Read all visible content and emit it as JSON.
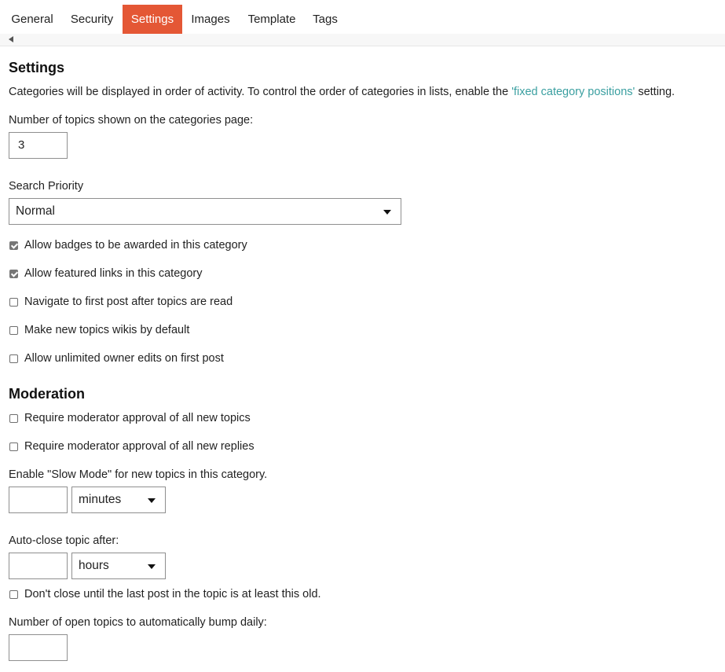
{
  "tabs": [
    {
      "label": "General",
      "active": false
    },
    {
      "label": "Security",
      "active": false
    },
    {
      "label": "Settings",
      "active": true
    },
    {
      "label": "Images",
      "active": false
    },
    {
      "label": "Template",
      "active": false
    },
    {
      "label": "Tags",
      "active": false
    }
  ],
  "settings": {
    "heading": "Settings",
    "description_prefix": "Categories will be displayed in order of activity. To control the order of categories in lists, enable the ",
    "description_link": "'fixed category positions'",
    "description_suffix": " setting.",
    "topics_shown_label": "Number of topics shown on the categories page:",
    "topics_shown_value": "3",
    "search_priority_label": "Search Priority",
    "search_priority_value": "Normal",
    "checkboxes": [
      {
        "label": "Allow badges to be awarded in this category",
        "checked": true
      },
      {
        "label": "Allow featured links in this category",
        "checked": true
      },
      {
        "label": "Navigate to first post after topics are read",
        "checked": false
      },
      {
        "label": "Make new topics wikis by default",
        "checked": false
      },
      {
        "label": "Allow unlimited owner edits on first post",
        "checked": false
      }
    ]
  },
  "moderation": {
    "heading": "Moderation",
    "checkboxes": [
      {
        "label": "Require moderator approval of all new topics",
        "checked": false
      },
      {
        "label": "Require moderator approval of all new replies",
        "checked": false
      }
    ],
    "slow_mode_label": "Enable \"Slow Mode\" for new topics in this category.",
    "slow_mode_value": "",
    "slow_mode_unit": "minutes",
    "auto_close_label": "Auto-close topic after:",
    "auto_close_value": "",
    "auto_close_unit": "hours",
    "dont_close_label": "Don't close until the last post in the topic is at least this old.",
    "dont_close_checked": false,
    "bump_label": "Number of open topics to automatically bump daily:",
    "bump_value": ""
  },
  "colors": {
    "active_tab": "#e45735",
    "link": "#3a9fa0"
  }
}
